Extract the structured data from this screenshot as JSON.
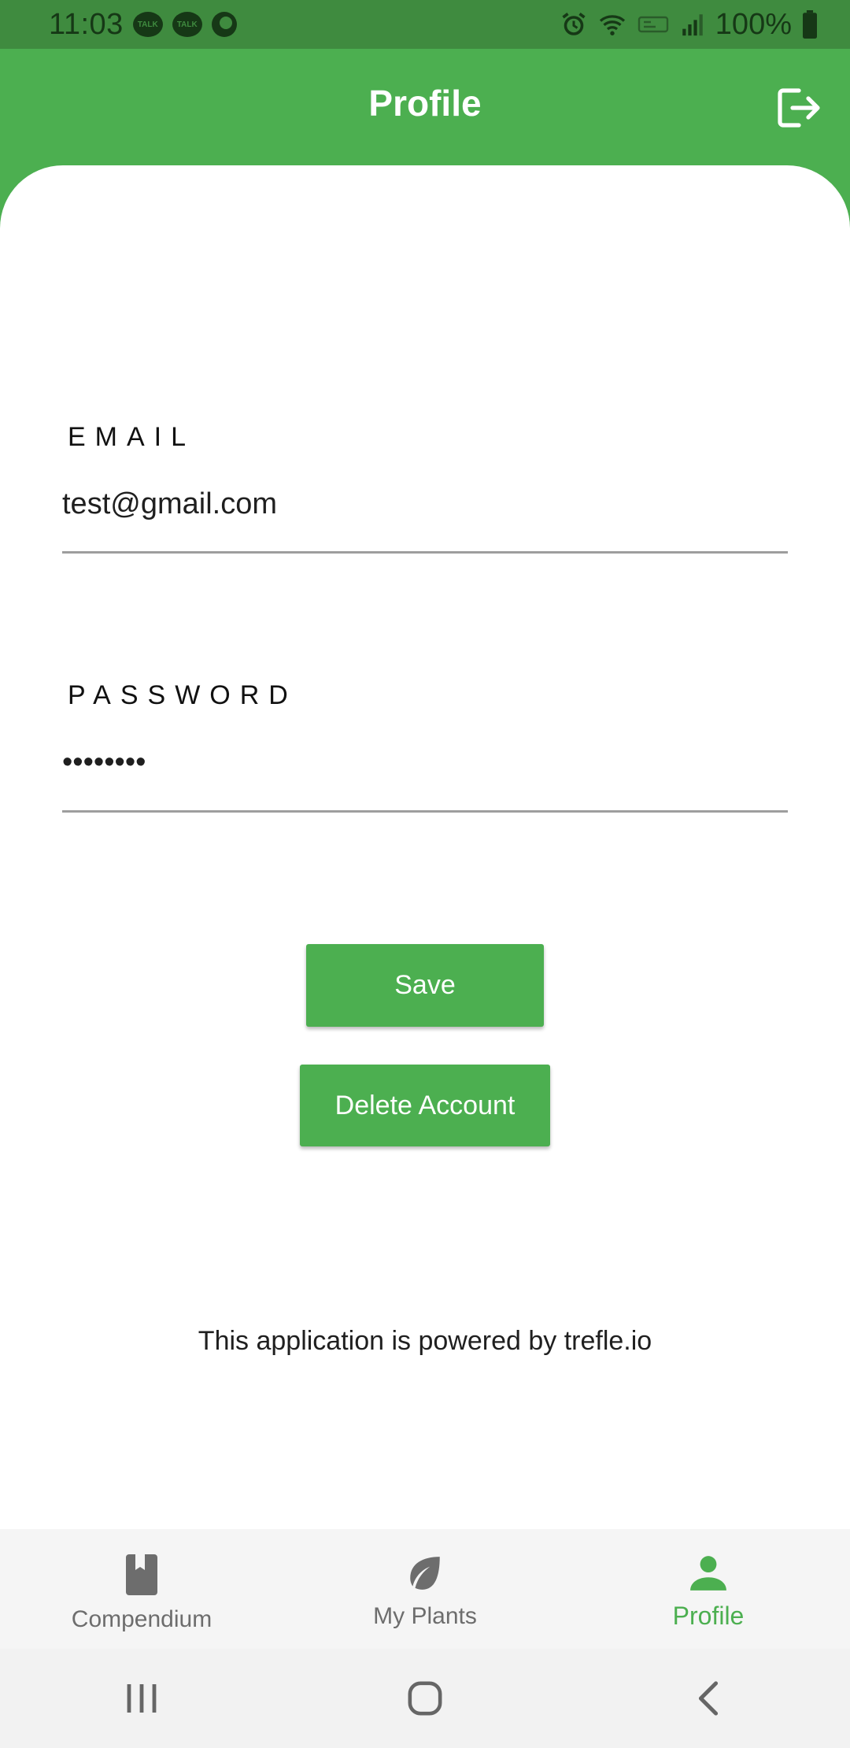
{
  "status_bar": {
    "time": "11:03",
    "notification_icons": [
      "talk-icon",
      "talk-icon",
      "moon-icon"
    ],
    "talk_label": "TALK",
    "system_icons": [
      "alarm-icon",
      "wifi-icon",
      "data-icon",
      "signal-icon"
    ],
    "battery": "100%"
  },
  "header": {
    "title": "Profile",
    "logout_icon": "logout-icon"
  },
  "form": {
    "email_label": "EMAIL",
    "email_value": "test@gmail.com",
    "password_label": "PASSWORD",
    "password_value": "••••••••"
  },
  "actions": {
    "save_label": "Save",
    "delete_label": "Delete Account"
  },
  "footer_text": "This application is powered by trefle.io",
  "bottom_nav": {
    "items": [
      {
        "label": "Compendium",
        "icon": "book-icon",
        "active": false
      },
      {
        "label": "My Plants",
        "icon": "leaf-icon",
        "active": false
      },
      {
        "label": "Profile",
        "icon": "person-icon",
        "active": true
      }
    ]
  },
  "colors": {
    "primary": "#4caf50",
    "status_bar": "#3f8b3f",
    "inactive": "#6d6d6d"
  }
}
